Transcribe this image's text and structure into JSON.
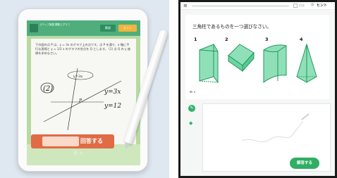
{
  "tablet": {
    "app_title": "ステップ演習 関数とグラフ",
    "hint_button": "解説",
    "hint_button2": "ヒント",
    "question": "下の図の点 P は、y = 3x のグラフ上の点です。点 P を通り、x 軸に平行な直線と y = 1/2 x のグラフの交点を Q とします。 (1) 点 Q の y 座標を求めなさい。",
    "work_labels": [
      "(2)",
      "y=3x",
      "y=12",
      "P"
    ],
    "ghost_text": "答 え",
    "answer_label": "回答する"
  },
  "screen": {
    "topbar": {
      "menu_icon": "≡",
      "small_label": "目次",
      "hint_label": "ヒント"
    },
    "question": "三角柱であるものを一つ選びなさい。",
    "options": [
      "1",
      "2",
      "3",
      "4"
    ],
    "format_label": "⊞ ∨",
    "submit_label": "解答する"
  },
  "colors": {
    "accent_green": "#2fae64",
    "shape_fill": "#8fe0b8",
    "shape_stroke": "#1f9a5a",
    "answer_orange": "#e06b45"
  },
  "icons": [
    "menu-icon",
    "hint-icon",
    "pen-icon",
    "eraser-icon"
  ]
}
